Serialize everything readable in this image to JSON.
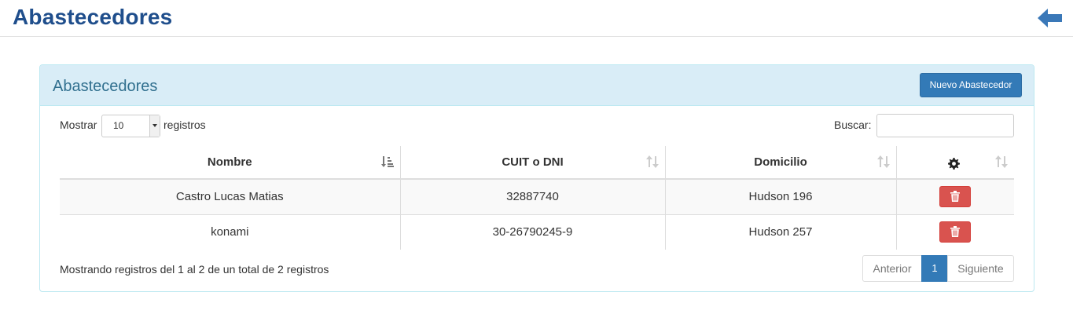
{
  "page": {
    "title": "Abastecedores",
    "back_icon": "arrow-left-icon",
    "accent_color": "#1f4e8c"
  },
  "panel": {
    "title": "Abastecedores",
    "new_button_label": "Nuevo Abastecedor"
  },
  "controls": {
    "show_label": "Mostrar",
    "length_value": "10",
    "records_label": "registros",
    "search_label": "Buscar:",
    "search_value": ""
  },
  "table": {
    "columns": [
      "Nombre",
      "CUIT o DNI",
      "Domicilio"
    ],
    "actions_icon": "gear-icon",
    "rows": [
      {
        "nombre": "Castro Lucas Matias",
        "cuit": "32887740",
        "domicilio": "Hudson 196",
        "action_icon": "trash-icon"
      },
      {
        "nombre": "konami",
        "cuit": "30-26790245-9",
        "domicilio": "Hudson 257",
        "action_icon": "trash-icon"
      }
    ]
  },
  "footer": {
    "info": "Mostrando registros del 1 al 2 de un total de 2 registros",
    "prev_label": "Anterior",
    "current_page": "1",
    "next_label": "Siguiente"
  }
}
